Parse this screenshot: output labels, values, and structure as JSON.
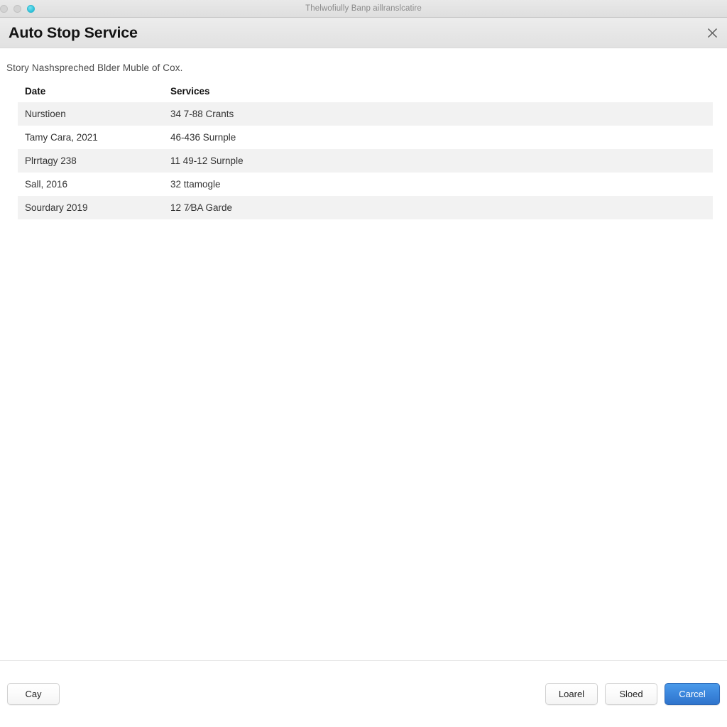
{
  "window": {
    "title": "Thelwofiully Banp aillranslcatire",
    "traffic_lights": [
      {
        "name": "close",
        "color": "#d3d3d3"
      },
      {
        "name": "minimize",
        "color": "#d3d3d3"
      },
      {
        "name": "zoom",
        "color": "#35c6dd"
      }
    ]
  },
  "header": {
    "title": "Auto Stop Service",
    "close_label": "×"
  },
  "main": {
    "intro": "Story Nashspreched Blder Muble of Cox.",
    "table": {
      "columns": [
        "Date",
        "Services"
      ],
      "rows": [
        {
          "date": "Nurstioen",
          "service": "34 7-88 Crants"
        },
        {
          "date": "Tamy Cara, 2021",
          "service": "46-436 Surnple"
        },
        {
          "date": "Plrrtagy 238",
          "service": "11 49-12 Surnple"
        },
        {
          "date": "Sall, 2016",
          "service": "32 ttamogle"
        },
        {
          "date": "Sourdary 2019",
          "service": "12 7⁄BA Garde"
        }
      ]
    }
  },
  "footer": {
    "left_button": "Cay",
    "buttons": [
      "Loarel",
      "Sloed"
    ],
    "primary_button": "Carcel",
    "primary_color": "#3b86dc"
  }
}
